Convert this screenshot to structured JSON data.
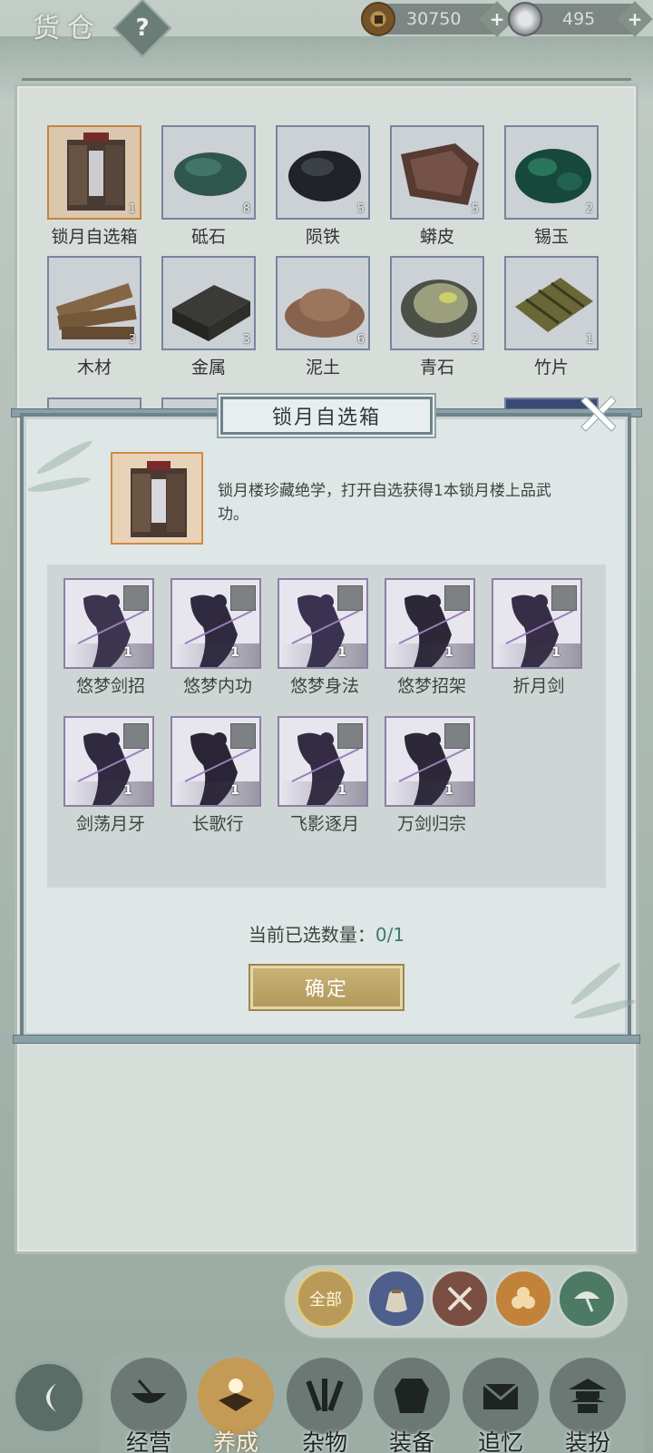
{
  "header": {
    "title": "货仓",
    "help_label": "?",
    "currencies": [
      {
        "icon": "copper-coin-icon",
        "value": "30750"
      },
      {
        "icon": "silver-ingot-icon",
        "value": "495"
      }
    ],
    "plus_label": "+"
  },
  "inventory": [
    {
      "name": "锁月自选箱",
      "count": "1",
      "selected": true
    },
    {
      "name": "砥石",
      "count": "8"
    },
    {
      "name": "陨铁",
      "count": "5"
    },
    {
      "name": "蟒皮",
      "count": "5"
    },
    {
      "name": "锡玉",
      "count": "2"
    },
    {
      "name": "木材",
      "count": "3"
    },
    {
      "name": "金属",
      "count": "3"
    },
    {
      "name": "泥土",
      "count": "6"
    },
    {
      "name": "青石",
      "count": "2"
    },
    {
      "name": "竹片",
      "count": "1"
    }
  ],
  "dialog": {
    "title": "锁月自选箱",
    "description": "锁月楼珍藏绝学，打开自选获得1本锁月楼上品武功。",
    "skills": [
      {
        "name": "悠梦剑招",
        "count": "1"
      },
      {
        "name": "悠梦内功",
        "count": "1"
      },
      {
        "name": "悠梦身法",
        "count": "1"
      },
      {
        "name": "悠梦招架",
        "count": "1"
      },
      {
        "name": "折月剑",
        "count": "1"
      },
      {
        "name": "剑荡月牙",
        "count": "1"
      },
      {
        "name": "长歌行",
        "count": "1"
      },
      {
        "name": "飞影逐月",
        "count": "1"
      },
      {
        "name": "万剑归宗",
        "count": "1"
      }
    ],
    "selected_label": "当前已选数量：",
    "selected_value": "0/1",
    "confirm_label": "确定"
  },
  "filters": [
    {
      "icon": "all-icon",
      "label": "全部",
      "active": true
    },
    {
      "icon": "bag-icon"
    },
    {
      "icon": "crossed-tools-icon"
    },
    {
      "icon": "logs-icon"
    },
    {
      "icon": "umbrella-icon"
    }
  ],
  "nav": [
    {
      "label": "经营",
      "icon": "bowl-icon"
    },
    {
      "label": "养成",
      "icon": "book-icon",
      "active": true
    },
    {
      "label": "杂物",
      "icon": "bundle-icon"
    },
    {
      "label": "装备",
      "icon": "robe-icon"
    },
    {
      "label": "追忆",
      "icon": "letter-icon"
    },
    {
      "label": "装扮",
      "icon": "pavilion-icon"
    }
  ],
  "colors": {
    "accent_gold": "#c59a55",
    "selected_border": "#d18a3e",
    "counter_value": "#3d7a6d"
  }
}
